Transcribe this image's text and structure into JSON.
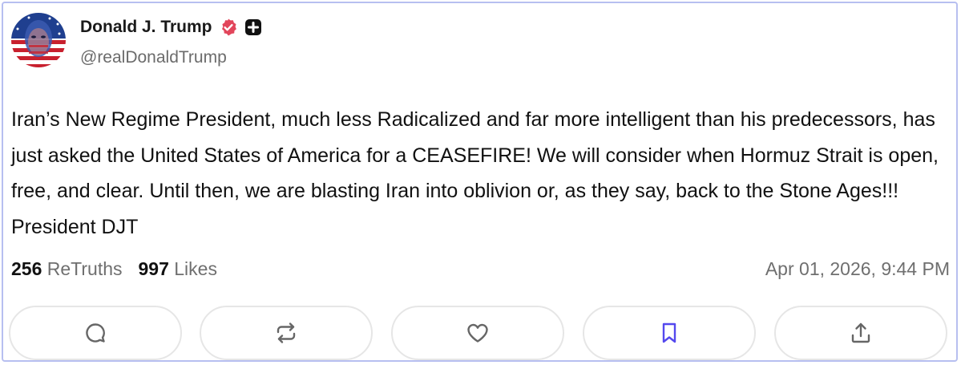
{
  "author": {
    "display_name": "Donald J. Trump",
    "handle": "@realDonaldTrump",
    "avatar_icon": "avatar-flag-portrait",
    "verified_icon": "verified-badge-icon",
    "plus_icon": "plus-badge-icon",
    "verified_color": "#e2455b"
  },
  "post": {
    "text": "Iran’s New Regime President, much less Radicalized and far more intelligent than his predecessors, has just asked the United States of America for a CEASEFIRE! We will consider when Hormuz Strait is open, free, and clear. Until then, we are blasting Iran into oblivion or, as they say, back to the Stone Ages!!! President DJT"
  },
  "stats": {
    "retruths_count": "256",
    "retruths_label": "ReTruths",
    "likes_count": "997",
    "likes_label": "Likes",
    "timestamp": "Apr 01, 2026, 9:44 PM"
  },
  "actions": [
    {
      "name": "reply",
      "icon": "comment-icon"
    },
    {
      "name": "retruth",
      "icon": "repost-icon"
    },
    {
      "name": "like",
      "icon": "heart-icon"
    },
    {
      "name": "bookmark",
      "icon": "bookmark-icon",
      "accent": "#5448ee"
    },
    {
      "name": "share",
      "icon": "share-icon"
    }
  ],
  "colors": {
    "card_border": "#b7bff0",
    "icon_gray": "#666666",
    "bookmark_accent": "#5448ee"
  }
}
